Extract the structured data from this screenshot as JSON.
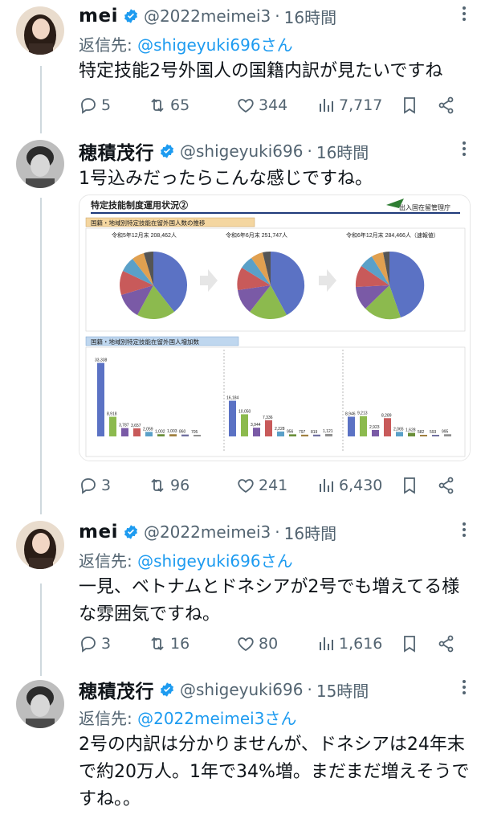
{
  "tweets": [
    {
      "name": "mei",
      "handle": "@2022meimei3",
      "time": "16時間",
      "reply_prefix": "返信先: ",
      "reply_to": "@shigeyuki696さん",
      "text": "特定技能2号外国人の国籍内訳が見たいですね",
      "replies": "5",
      "retweets": "65",
      "likes": "344",
      "views": "7,717"
    },
    {
      "name": "穂積茂行",
      "handle": "@shigeyuki696",
      "time": "16時間",
      "text": "1号込みだったらこんな感じですね。",
      "replies": "3",
      "retweets": "96",
      "likes": "241",
      "views": "6,430"
    },
    {
      "name": "mei",
      "handle": "@2022meimei3",
      "time": "16時間",
      "reply_prefix": "返信先: ",
      "reply_to": "@shigeyuki696さん",
      "text": "一見、ベトナムとドネシアが2号でも増えてる様な雰囲気ですね。",
      "replies": "3",
      "retweets": "16",
      "likes": "80",
      "views": "1,616"
    },
    {
      "name": "穂積茂行",
      "handle": "@shigeyuki696",
      "time": "15時間",
      "reply_prefix": "返信先: ",
      "reply_to": "@2022meimei3さん",
      "text": "2号の内訳は分かりませんが、ドネシアは24年末で約20万人。1年で34%増。まだまだ増えそうですね。。"
    }
  ],
  "image": {
    "title": "特定技能制度運用状況②",
    "agency": "出入国在留管理庁",
    "section1": "国籍・地域別特定技能在留外国人数の推移",
    "section2": "国籍・地域別特定技能在留外国人増加数",
    "pie_labels": [
      "令和5年12月末 208,462人",
      "令和6年6月末 251,747人",
      "令和6年12月末 284,466人（速報値）"
    ],
    "bars_a": [
      "33,338",
      "8,918",
      "3,787",
      "3,657",
      "2,059",
      "1,002",
      "1,003",
      "860",
      "705"
    ],
    "bars_b": [
      "16,184",
      "10,050",
      "3,944",
      "7,336",
      "2,228",
      "956",
      "797",
      "819",
      "1,121"
    ],
    "bars_c": [
      "8,946",
      "9,213",
      "2,923",
      "8,289",
      "2,065",
      "1,628",
      "582",
      "593",
      "995"
    ]
  },
  "colors": {
    "accent": "#1d9bf0",
    "muted": "#536471",
    "line": "#cfd9de"
  }
}
